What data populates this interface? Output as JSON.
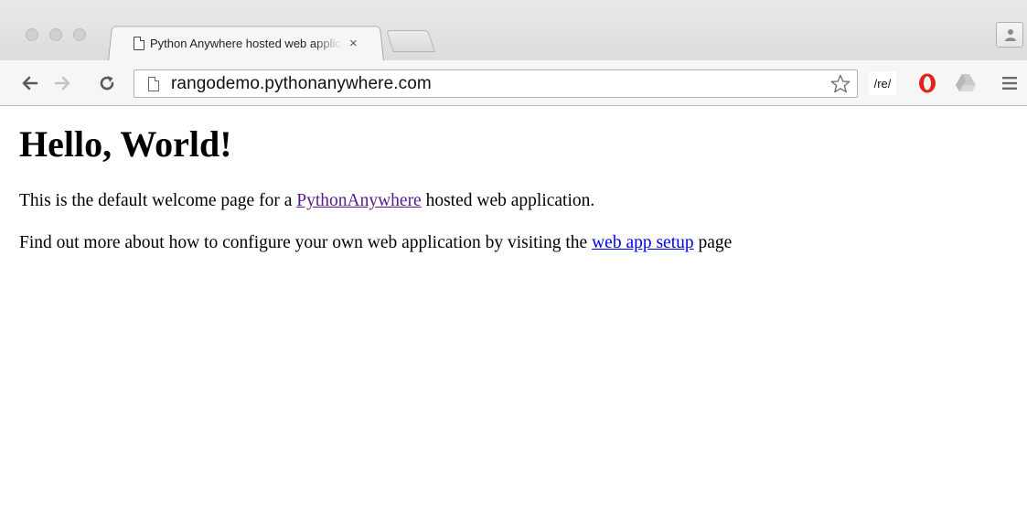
{
  "tab": {
    "title": "Python Anywhere hosted web application",
    "close_label": "×"
  },
  "toolbar": {
    "url": "rangodemo.pythonanywhere.com",
    "extension_re_label": "/re/"
  },
  "page": {
    "heading": "Hello, World!",
    "para1_before": "This is the default welcome page for a ",
    "para1_link": "PythonAnywhere",
    "para1_after": " hosted web application.",
    "para2_before": "Find out more about how to configure your own web application by visiting the ",
    "para2_link": "web app setup",
    "para2_after": " page"
  },
  "colors": {
    "visited_link": "#551a8b",
    "link": "#0000ee",
    "opera_red": "#e2231a",
    "drive_gray": "#c9c9c9"
  },
  "icons": {
    "back": "arrow-left-icon",
    "forward": "arrow-right-icon",
    "reload": "reload-icon",
    "star": "star-icon",
    "menu": "hamburger-menu-icon",
    "profile": "person-icon",
    "opera": "opera-icon",
    "drive": "drive-icon",
    "page": "page-icon"
  }
}
